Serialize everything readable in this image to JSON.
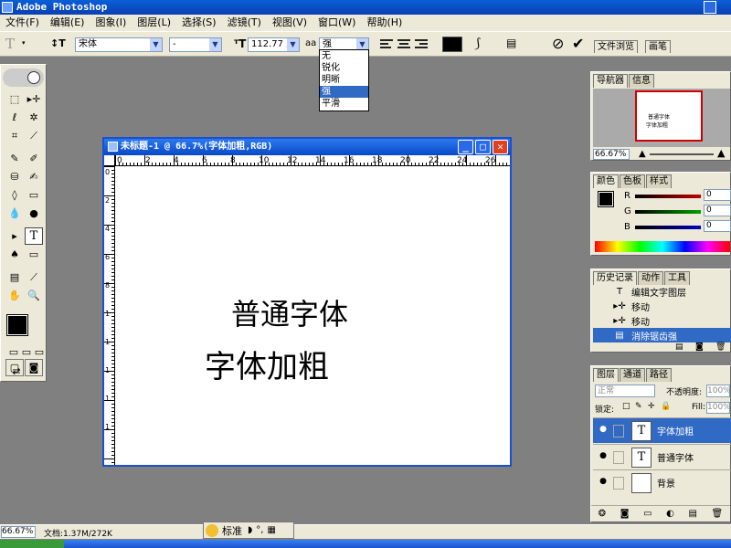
{
  "window": {
    "title": "Adobe Photoshop"
  },
  "menu": [
    "文件(F)",
    "编辑(E)",
    "图象(I)",
    "图层(L)",
    "选择(S)",
    "滤镜(T)",
    "视图(V)",
    "窗口(W)",
    "帮助(H)"
  ],
  "options_bar": {
    "font_family": "宋体",
    "font_style": "-",
    "font_size": "112.77 点",
    "aa_label": "aa",
    "antialias": "强",
    "antialias_options": [
      "无",
      "锐化",
      "明晰",
      "强",
      "平滑"
    ],
    "antialias_selected_index": 3,
    "text_color": "#000000"
  },
  "palette_well": {
    "tabs": [
      "文件浏览",
      "画笔"
    ]
  },
  "document": {
    "title": "未标题-1 @ 66.7%(字体加粗,RGB)",
    "ruler_top_labels": [
      "0",
      "2",
      "4",
      "6",
      "8",
      "10",
      "12",
      "14",
      "16",
      "18",
      "20",
      "22",
      "24",
      "26"
    ],
    "ruler_left_labels": [
      "0",
      "2",
      "4",
      "6",
      "8",
      "1",
      "1",
      "1",
      "1",
      "1"
    ],
    "text1": "普通字体",
    "text2": "字体加粗"
  },
  "navigator": {
    "tabs": [
      "导航器",
      "信息"
    ],
    "thumb_line1": "普通字体",
    "thumb_line2": "字体加粗",
    "zoom": "66.67%"
  },
  "color": {
    "tabs": [
      "颜色",
      "色板",
      "样式"
    ],
    "channels": [
      {
        "label": "R",
        "value": "0",
        "color": "#c00000"
      },
      {
        "label": "G",
        "value": "0",
        "color": "#00a000"
      },
      {
        "label": "B",
        "value": "0",
        "color": "#0000c0"
      }
    ]
  },
  "history": {
    "tabs": [
      "历史记录",
      "动作",
      "工具"
    ],
    "items": [
      {
        "icon": "T",
        "label": "编辑文字图层",
        "selected": false
      },
      {
        "icon": "▸✛",
        "label": "移动",
        "selected": false
      },
      {
        "icon": "▸✛",
        "label": "移动",
        "selected": false
      },
      {
        "icon": "▤",
        "label": "消除锯齿强",
        "selected": true
      }
    ]
  },
  "layers": {
    "tabs": [
      "图层",
      "通道",
      "路径"
    ],
    "blend_mode": "正常",
    "opacity_label": "不透明度:",
    "opacity": "100%",
    "lock_label": "锁定:",
    "fill_label": "Fill:",
    "fill": "100%",
    "items": [
      {
        "name": "字体加粗",
        "type": "T",
        "selected": true
      },
      {
        "name": "普通字体",
        "type": "T",
        "selected": false
      },
      {
        "name": "背景",
        "type": "",
        "selected": false
      }
    ]
  },
  "status": {
    "zoom": "66.67%",
    "doc_info": "文档:1.37M/272K"
  },
  "ime": {
    "label": "标准"
  }
}
